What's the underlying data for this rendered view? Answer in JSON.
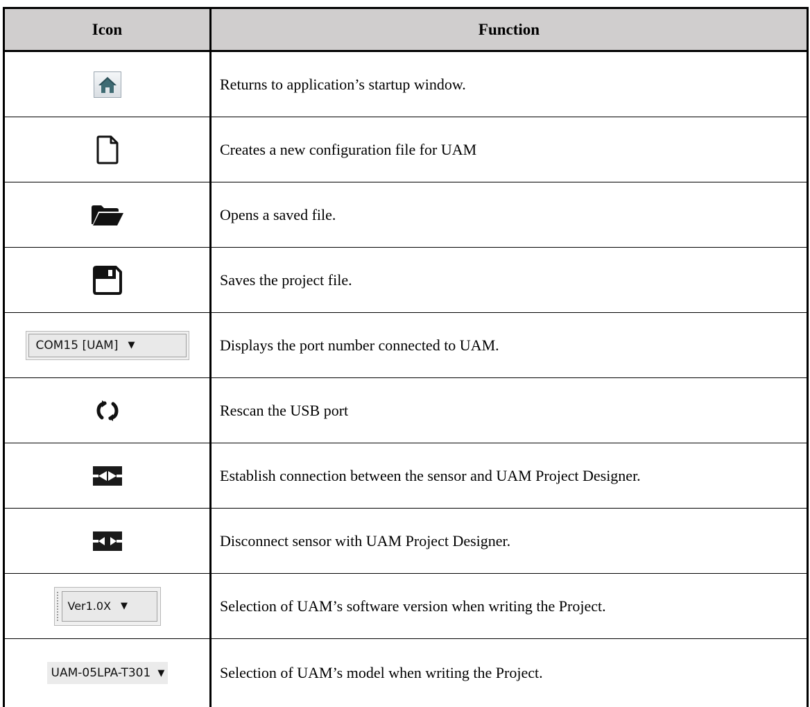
{
  "table": {
    "header": {
      "icon": "Icon",
      "function": "Function"
    },
    "rows": [
      {
        "icon": "home-icon",
        "function": "Returns to application’s startup window."
      },
      {
        "icon": "new-file-icon",
        "function": "Creates a new configuration file for UAM"
      },
      {
        "icon": "folder-open-icon",
        "function": "Opens a saved file."
      },
      {
        "icon": "save-icon",
        "function": "Saves the project file."
      },
      {
        "icon": "port-dropdown",
        "dropdown_value": "COM15 [UAM]",
        "function": "Displays the port number connected to UAM."
      },
      {
        "icon": "refresh-icon",
        "function": "Rescan the USB port"
      },
      {
        "icon": "connect-icon",
        "function": "Establish connection between the sensor and UAM Project Designer."
      },
      {
        "icon": "disconnect-icon",
        "function": "Disconnect sensor with UAM Project Designer."
      },
      {
        "icon": "version-dropdown",
        "dropdown_value": "Ver1.0X",
        "function": "Selection of UAM’s software version when writing the Project."
      },
      {
        "icon": "model-dropdown",
        "dropdown_value": "UAM-05LPA-T301",
        "function": "Selection of UAM’s model when writing the Project."
      }
    ]
  },
  "colors": {
    "header_bg": "#d0cece",
    "border": "#000000",
    "home_icon": "#3f6b73"
  },
  "glyphs": {
    "dropdown_arrow": "▼"
  }
}
